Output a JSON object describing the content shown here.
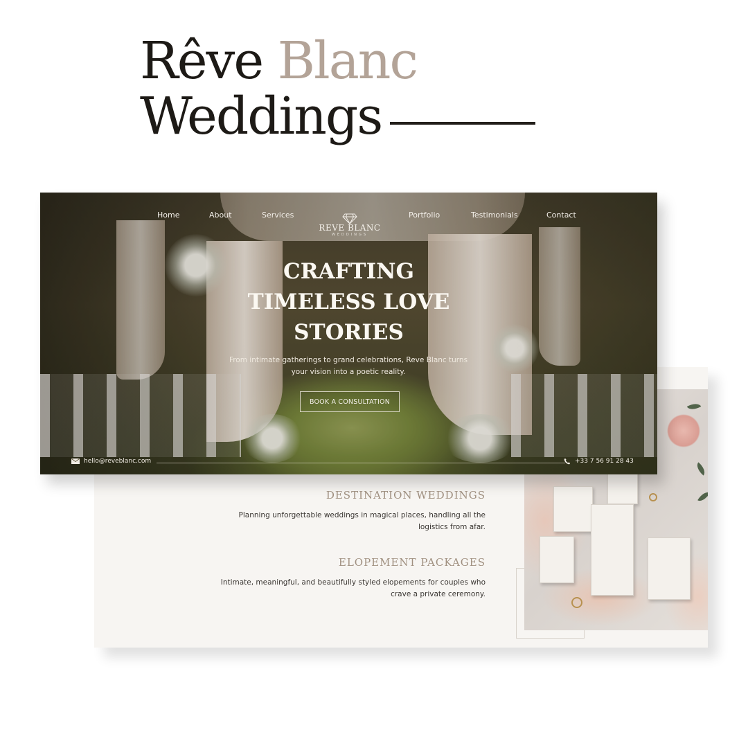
{
  "headline": {
    "word1": "Rêve",
    "word2": "Blanc",
    "word3": "Weddings"
  },
  "colors": {
    "accent_taupe": "#b3a397",
    "ink": "#1d1a16",
    "service_title": "#a09080",
    "card_bg": "#f7f5f2"
  },
  "hero": {
    "nav": {
      "home": "Home",
      "about": "About",
      "services": "Services",
      "portfolio": "Portfolio",
      "testimonials": "Testimonials",
      "contact": "Contact"
    },
    "logo": {
      "icon": "diamond-icon",
      "name": "REVE BLANC",
      "sub": "WEDDINGS"
    },
    "heading": {
      "line1": "CRAFTING",
      "line2": "TIMELESS LOVE",
      "line3": "STORIES"
    },
    "subtitle": "From intimate gatherings to grand celebrations, Reve Blanc turns your vision into a poetic reality.",
    "cta_label": "BOOK A CONSULTATION",
    "email": "hello@reveblanc.com",
    "email_icon": "envelope-icon",
    "phone": "+33 7 56 91 28 43",
    "phone_icon": "phone-icon"
  },
  "services": [
    {
      "title": "DESTINATION WEDDINGS",
      "description": "Planning unforgettable weddings in magical places, handling all the logistics from afar."
    },
    {
      "title": "ELOPEMENT PACKAGES",
      "description": "Intimate, meaningful, and beautifully styled elopements for couples who crave a private ceremony."
    }
  ]
}
